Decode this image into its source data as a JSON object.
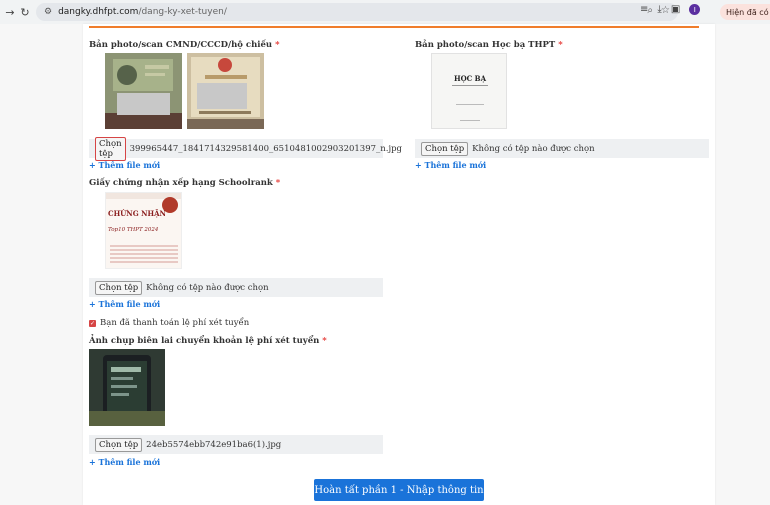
{
  "browser": {
    "url_host": "dangky.dhfpt.com",
    "url_path": "/dang-ky-xet-tuyen/",
    "profile_initial": "I",
    "extension_text": "Hiện đã có C"
  },
  "form": {
    "id_card": {
      "label": "Bản photo/scan CMND/CCCD/hộ chiếu",
      "required": "*",
      "button": "Chọn tệp",
      "file_name": "399965447_1841714329581400_6510481002903201397_n.jpg"
    },
    "transcript": {
      "label": "Bản photo/scan Học bạ THPT",
      "required": "*",
      "button": "Chọn tệp",
      "file_name": "Không có tệp nào được chọn",
      "preview_title": "HỌC BẠ"
    },
    "schoolrank": {
      "label": "Giấy chứng nhận xếp hạng Schoolrank",
      "required": "*",
      "button": "Chọn tệp",
      "file_name": "Không có tệp nào được chọn",
      "preview_heading": "CHỨNG NHẬN",
      "preview_sub": "Top10 THPT 2024"
    },
    "paid_checkbox": "Bạn đã thanh toán lệ phí xét tuyển",
    "receipt": {
      "label": "Ảnh chụp biên lai chuyển khoản lệ phí xét tuyển",
      "required": "*",
      "button": "Chọn tệp",
      "file_name": "24eb5574ebb742e91ba6(1).jpg"
    },
    "add_more": "+ Thêm file mới",
    "submit": "Hoàn tất phần 1 - Nhập thông tin"
  },
  "colors": {
    "accent": "#f07d2b",
    "link": "#1a73d9",
    "required": "#e53935",
    "submit": "#1a73d9"
  }
}
